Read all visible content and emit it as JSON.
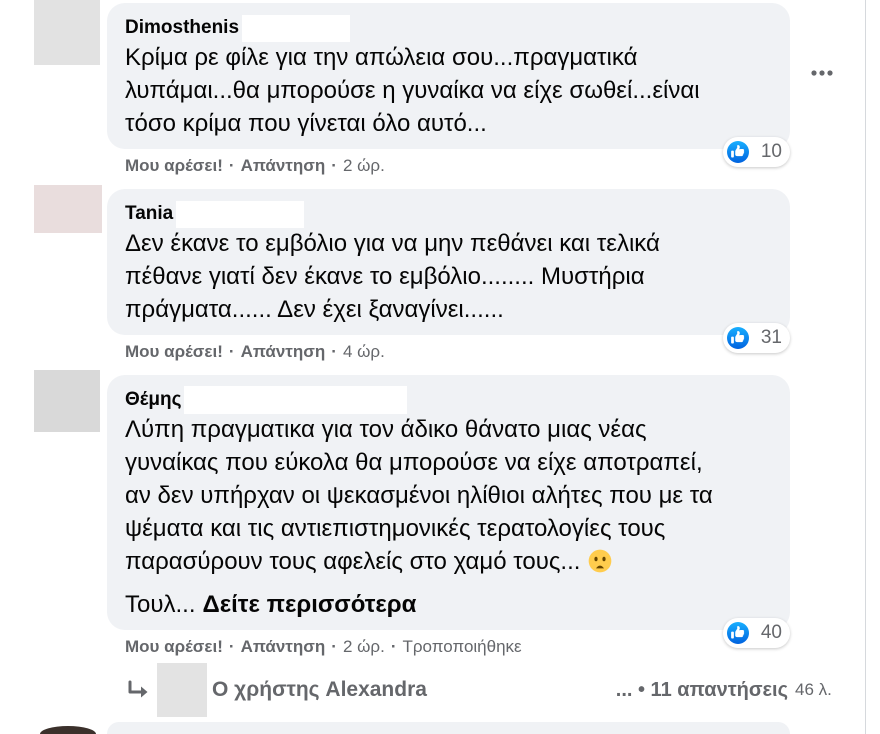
{
  "colors": {
    "page_background": "#ffffff",
    "bubble_background": "#f0f2f5",
    "primary_text": "#050505",
    "secondary_text": "#65676b",
    "like_blue": "#1877f2"
  },
  "separator": "·",
  "comments": [
    {
      "author": "Dimosthenis",
      "lines": [
        "Κρίμα ρε φίλε για την απώλεια σου...πραγματικά",
        "λυπάμαι...θα μπορούσε η γυναίκα να είχε σωθεί...είναι",
        "τόσο κρίμα που γίνεται όλο αυτό..."
      ],
      "reaction": {
        "icon": "like-icon",
        "count": "10"
      },
      "actions": {
        "like": "Μου αρέσει!",
        "reply": "Απάντηση",
        "time": "2 ώρ."
      },
      "options_icon": "more-options-icon"
    },
    {
      "author": "Tania",
      "lines": [
        "Δεν έκανε το εμβόλιο για να μην πεθάνει και τελικά",
        "πέθανε γιατί δεν έκανε το εμβόλιο........ Μυστήρια",
        "πράγματα...... Δεν έχει ξαναγίνει......"
      ],
      "reaction": {
        "icon": "like-icon",
        "count": "31"
      },
      "actions": {
        "like": "Μου αρέσει!",
        "reply": "Απάντηση",
        "time": "4 ώρ."
      }
    },
    {
      "author": "Θέμης",
      "lines": [
        "Λύπη πραγματικα για τον άδικο θάνατο μιας νέας",
        "γυναίκας που εύκολα θα μπορούσε να είχε αποτραπεί,",
        "αν δεν υπήρχαν οι ψεκασμένοι ηλίθιοι αλήτες που με τα",
        "ψέματα και τις αντιεπιστημονικές τερατολογίες τους",
        "παρασύρουν τους αφελείς στο χαμό τους..."
      ],
      "emoji": "frowning-face-emoji",
      "truncated_text": "Τουλ...",
      "see_more": "Δείτε περισσότερα",
      "reaction": {
        "icon": "like-icon",
        "count": "40"
      },
      "actions": {
        "like": "Μου αρέσει!",
        "reply": "Απάντηση",
        "time": "2 ώρ.",
        "edited": "Τροποποιήθηκε"
      }
    }
  ],
  "reply_summary": {
    "icon": "reply-arrow-icon",
    "author_text": "Ο χρήστης Alexandra",
    "replies_text": "... • 11 απαντήσεις",
    "age": "46 λ."
  }
}
